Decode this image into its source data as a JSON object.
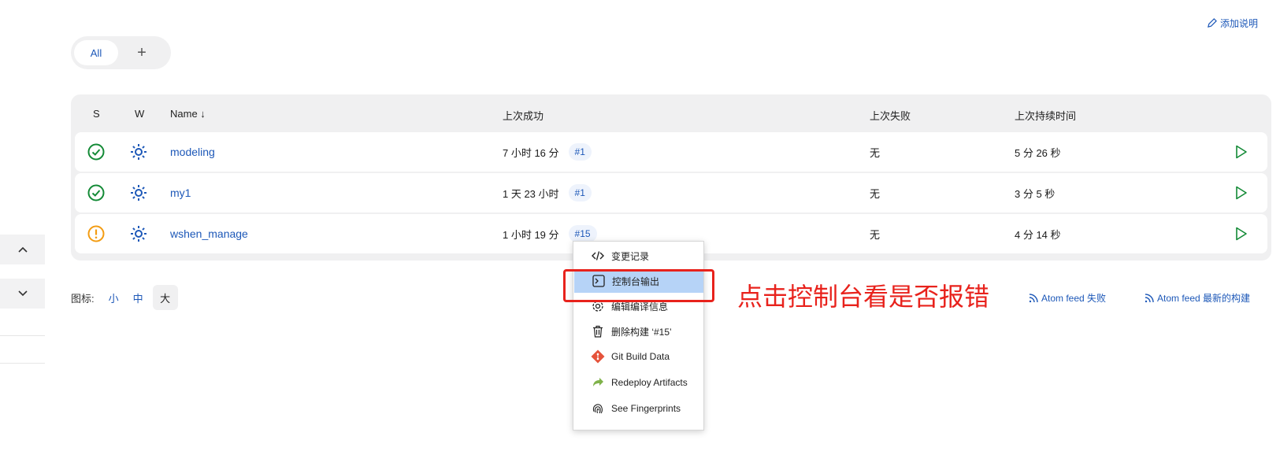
{
  "header": {
    "add_description": "添加说明"
  },
  "view_tabs": {
    "all": "All",
    "add": "+"
  },
  "table": {
    "headers": {
      "s": "S",
      "w": "W",
      "name": "Name ↓",
      "last_success": "上次成功",
      "last_failure": "上次失败",
      "last_duration": "上次持续时间"
    },
    "rows": [
      {
        "name": "modeling",
        "status": "success",
        "last_success": "7 小时 16 分",
        "build": "#1",
        "last_failure": "无",
        "last_duration": "5 分 26 秒"
      },
      {
        "name": "my1",
        "status": "success",
        "last_success": "1 天 23 小时",
        "build": "#1",
        "last_failure": "无",
        "last_duration": "3 分 5 秒"
      },
      {
        "name": "wshen_manage",
        "status": "warning",
        "last_success": "1 小时 19 分",
        "build": "#15",
        "last_failure": "无",
        "last_duration": "4 分 14 秒"
      }
    ]
  },
  "legend": {
    "label": "图标:",
    "small": "小",
    "medium": "中",
    "large": "大"
  },
  "feeds": {
    "fail": "Atom feed 失败",
    "latest": "Atom feed 最新的构建"
  },
  "context_menu": {
    "items": [
      {
        "label": "变更记录",
        "icon": "code-icon"
      },
      {
        "label": "控制台输出",
        "icon": "terminal-icon"
      },
      {
        "label": "编辑编译信息",
        "icon": "gear-icon"
      },
      {
        "label": "删除构建 ‘#15’",
        "icon": "trash-icon"
      },
      {
        "label": "Git Build Data",
        "icon": "git-icon"
      },
      {
        "label": "Redeploy Artifacts",
        "icon": "redeploy-icon"
      },
      {
        "label": "See Fingerprints",
        "icon": "fingerprint-icon"
      }
    ]
  },
  "annotation": {
    "text": "点击控制台看是否报错"
  },
  "colors": {
    "link": "#1d58b8",
    "success": "#138a36",
    "warning": "#f39c12",
    "annotation": "#e8221c",
    "menu_active": "#b6d3f7"
  }
}
